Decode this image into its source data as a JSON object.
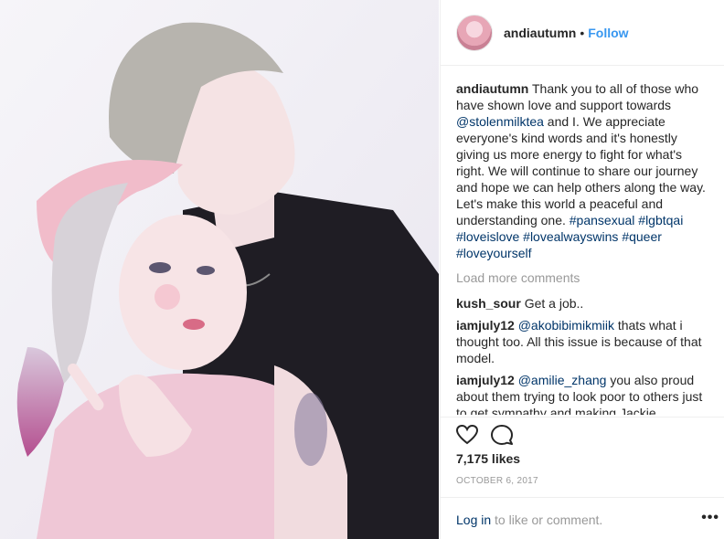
{
  "post": {
    "image_description_name": "photo-of-two-people",
    "author": "andiautumn",
    "separator": "•",
    "follow_label": "Follow",
    "caption": {
      "username": "andiautumn",
      "text_a": " Thank you to all of those who have shown love and support towards ",
      "mention": "@stolenmilktea",
      "text_b": " and I. We appreciate everyone's kind words and it's honestly giving us more energy to fight for what's right. We will continue to share our journey and hope we can help others along the way. Let's make this world a peaceful and understanding one. ",
      "tags": [
        "#pansexual",
        "#lgbtqai",
        "#loveislove",
        "#lovealwayswins",
        "#queer",
        "#loveyourself"
      ]
    },
    "load_more": "Load more comments",
    "comments": [
      {
        "username": "kush_sour",
        "mention": "",
        "text": " Get a job.."
      },
      {
        "username": "iamjuly12",
        "mention": "@akobibimikmiik",
        "text": " thats what i thought too. All this issue is because of that model."
      },
      {
        "username": "iamjuly12",
        "mention": "@amilie_zhang",
        "text": " you also proud about them trying to look poor to others just to get sympathy and making Jackie"
      }
    ],
    "likes": "7,175 likes",
    "date": "OCTOBER 6, 2017",
    "login_link": "Log in",
    "login_rest": " to like or comment.",
    "more_label": "•••",
    "icons": {
      "like": "heart-icon",
      "comment": "comment-icon",
      "more": "more-options-icon"
    },
    "colors": {
      "link": "#3897f0",
      "mention": "#003569",
      "muted": "#999999",
      "text": "#262626"
    }
  }
}
